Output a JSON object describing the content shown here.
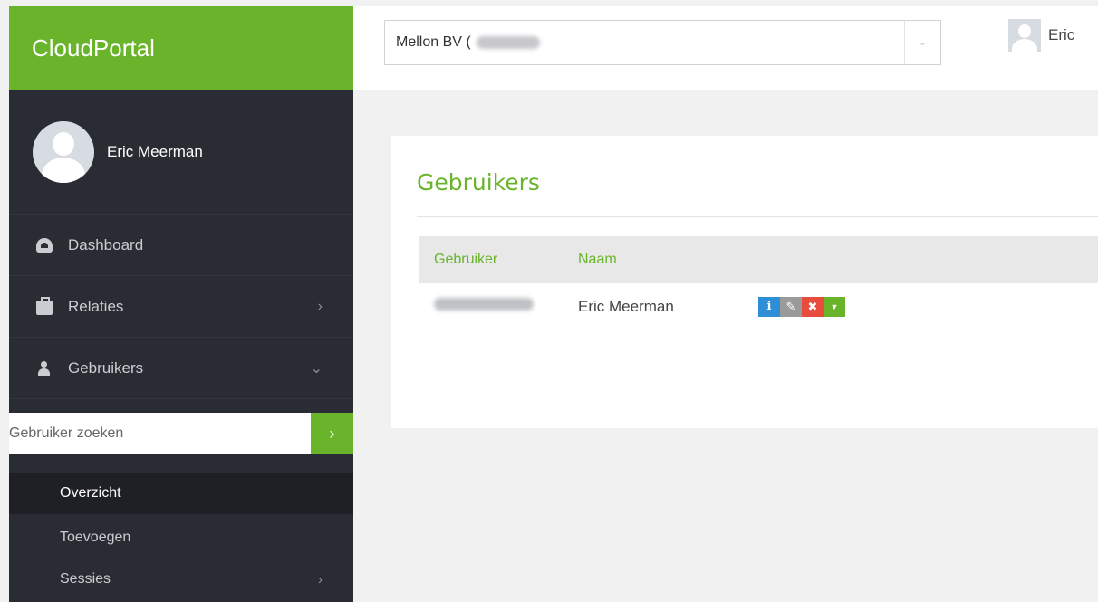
{
  "brand": {
    "title": "CloudPortal"
  },
  "profile": {
    "name": "Eric Meerman"
  },
  "nav": {
    "dashboard": {
      "label": "Dashboard"
    },
    "relaties": {
      "label": "Relaties",
      "arrow": "›"
    },
    "gebruikers": {
      "label": "Gebruikers",
      "arrow": "⌄"
    }
  },
  "search": {
    "placeholder": "Gebruiker zoeken",
    "button": "›"
  },
  "submenu": {
    "overzicht": {
      "label": "Overzicht"
    },
    "toevoegen": {
      "label": "Toevoegen"
    },
    "sessies": {
      "label": "Sessies",
      "arrow": "›"
    }
  },
  "topbar": {
    "org_select_value": "Mellon BV (",
    "org_caret": "⌄",
    "user_name": "Eric"
  },
  "panel": {
    "title": "Gebruikers",
    "columns": [
      "Gebruiker",
      "Naam"
    ],
    "rows": [
      {
        "gebruiker": "",
        "naam": "Eric Meerman"
      }
    ],
    "actions": {
      "info": "i",
      "edit": "✎",
      "delete": "✖",
      "more": "▼"
    }
  },
  "colors": {
    "accent": "#6ab42c",
    "sidebar": "#2a2c33",
    "info": "#2f8fd6",
    "danger": "#e74c3c"
  }
}
